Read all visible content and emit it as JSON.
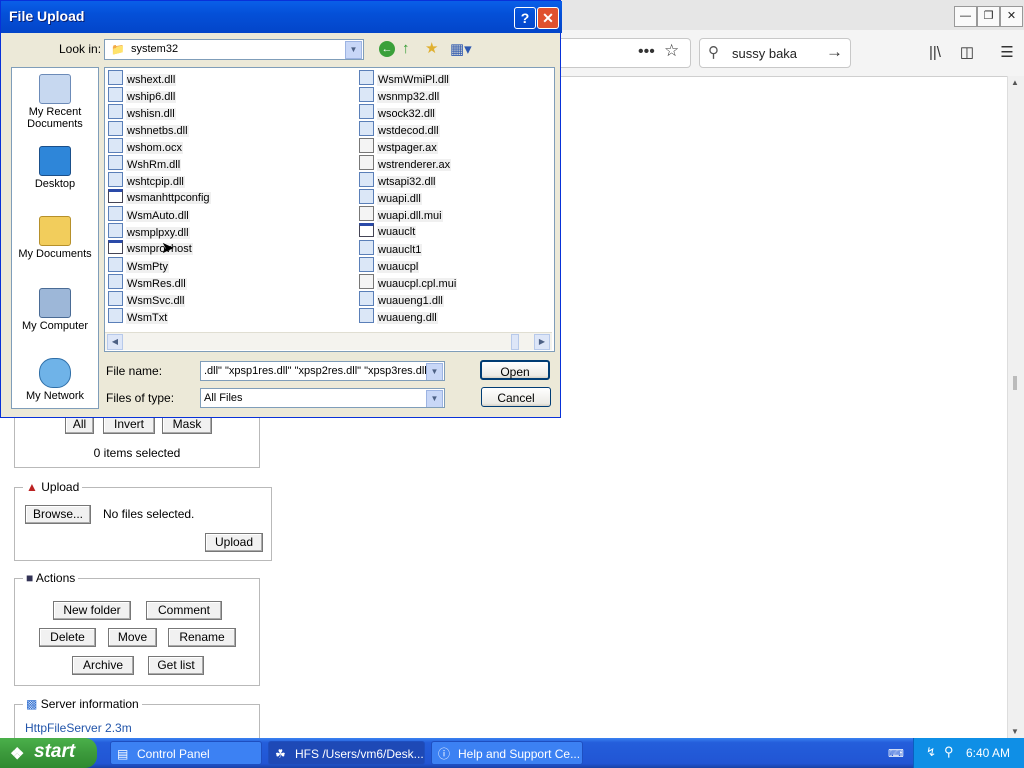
{
  "dialog": {
    "title": "File Upload",
    "look_in_label": "Look in:",
    "look_in_value": "system32",
    "places": [
      "My Recent Documents",
      "Desktop",
      "My Documents",
      "My Computer",
      "My Network"
    ],
    "files_col1": [
      "wshext.dll",
      "wship6.dll",
      "wshisn.dll",
      "wshnetbs.dll",
      "wshom.ocx",
      "WshRm.dll",
      "wshtcpip.dll",
      "wsmanhttpconfig",
      "WsmAuto.dll",
      "wsmplpxy.dll",
      "wsmprovhost",
      "WsmPty",
      "WsmRes.dll",
      "WsmSvc.dll",
      "WsmTxt"
    ],
    "files_col2": [
      "WsmWmiPl.dll",
      "wsnmp32.dll",
      "wsock32.dll",
      "wstdecod.dll",
      "wstpager.ax",
      "wstrenderer.ax",
      "wtsapi32.dll",
      "wuapi.dll",
      "wuapi.dll.mui",
      "wuauclt",
      "wuauclt1",
      "wuaucpl",
      "wuaucpl.cpl.mui",
      "wuaueng1.dll",
      "wuaueng.dll"
    ],
    "file_name_label": "File name:",
    "file_name_value": ".dll\" \"xpsp1res.dll\" \"xpsp2res.dll\" \"xpsp3res.dll\"",
    "files_of_type_label": "Files of type:",
    "files_of_type_value": "All Files",
    "open_label": "Open",
    "cancel_label": "Cancel"
  },
  "browser": {
    "search_value": "sussy baka",
    "more_icon": "ellipsis-icon"
  },
  "hfs": {
    "select_buttons": [
      "All",
      "Invert",
      "Mask"
    ],
    "selected_status": "0 items selected",
    "upload_legend": "Upload",
    "browse_label": "Browse...",
    "no_files": "No files selected.",
    "upload_button": "Upload",
    "actions_legend": "Actions",
    "actions_row1": [
      "New folder",
      "Comment"
    ],
    "actions_row2": [
      "Delete",
      "Move",
      "Rename"
    ],
    "actions_row3": [
      "Archive",
      "Get list"
    ],
    "server_legend": "Server information",
    "server_link": "HttpFileServer 2.3m"
  },
  "taskbar": {
    "start_label": "start",
    "tasks": [
      "Control Panel",
      "HFS /Users/vm6/Desk...",
      "Help and Support Ce..."
    ],
    "clock": "6:40 AM"
  }
}
